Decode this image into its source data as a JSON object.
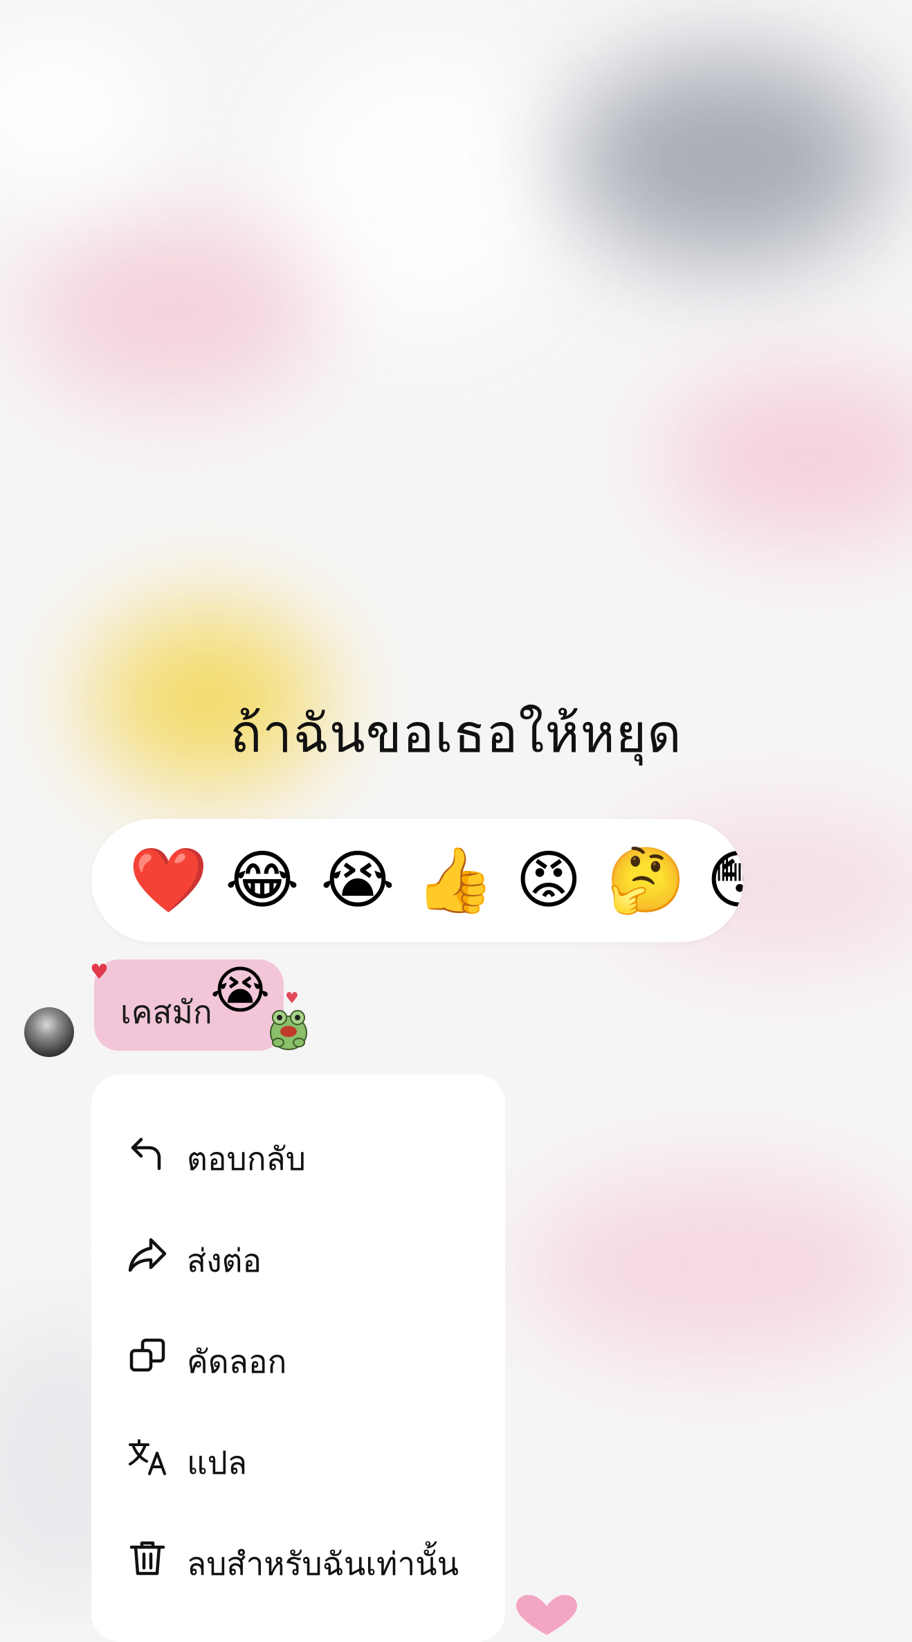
{
  "conversation": {
    "headline": "ถ้าฉันขอเธอให้หยุด"
  },
  "reactions": [
    {
      "name": "heart",
      "glyph": "❤️"
    },
    {
      "name": "tears-of-joy",
      "glyph": "😂"
    },
    {
      "name": "crying",
      "glyph": "😭"
    },
    {
      "name": "thumbs-up",
      "glyph": "👍"
    },
    {
      "name": "angry",
      "glyph": "😡"
    },
    {
      "name": "thinking",
      "glyph": "🤔"
    },
    {
      "name": "surprised",
      "glyph": "😳"
    }
  ],
  "message": {
    "text": "เคสมัก",
    "emoji": "😭",
    "reaction_glyph": "♥",
    "bubble_color": "#f2c6d8"
  },
  "context_menu": {
    "items": [
      {
        "label": "ตอบกลับ",
        "icon": "reply-icon"
      },
      {
        "label": "ส่งต่อ",
        "icon": "forward-icon"
      },
      {
        "label": "คัดลอก",
        "icon": "copy-icon"
      },
      {
        "label": "แปล",
        "icon": "translate-icon"
      },
      {
        "label": "ลบสำหรับฉันเท่านั้น",
        "icon": "trash-icon"
      }
    ]
  },
  "colors": {
    "text": "#111111",
    "menu_bg": "#ffffff",
    "accent_heart": "#e23a4a"
  }
}
